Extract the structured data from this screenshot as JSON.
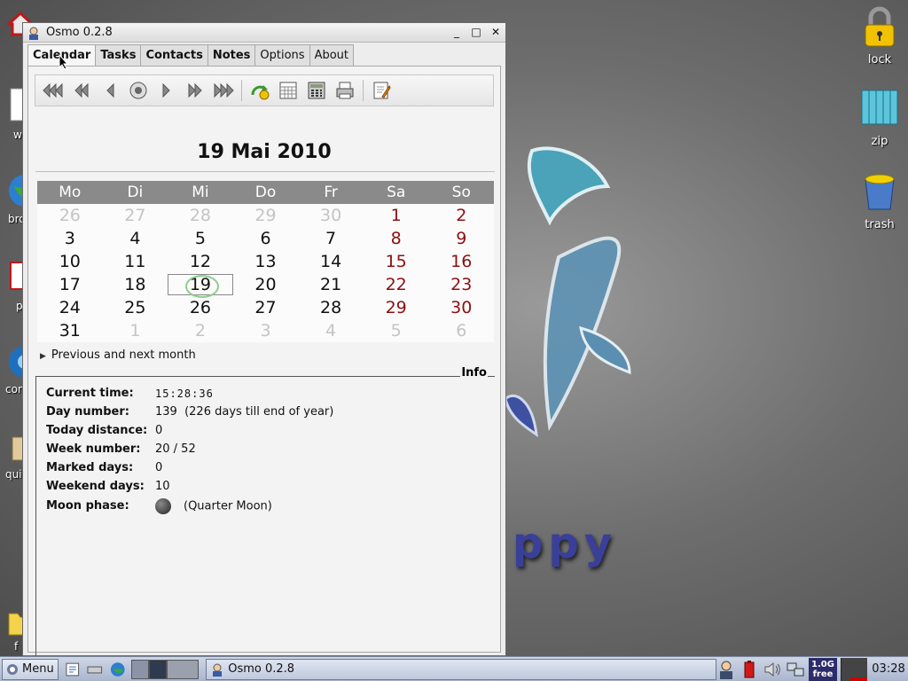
{
  "window": {
    "title": "Osmo 0.2.8",
    "minimize": "_",
    "maximize": "□",
    "close": "✕"
  },
  "tabs": [
    {
      "label": "Calendar"
    },
    {
      "label": "Tasks"
    },
    {
      "label": "Contacts"
    },
    {
      "label": "Notes"
    },
    {
      "label": "Options"
    },
    {
      "label": "About"
    }
  ],
  "toolbar": {
    "icons": [
      "prev-year-icon",
      "prev-month-icon",
      "prev-day-icon",
      "today-icon",
      "next-day-icon",
      "next-month-icon",
      "next-year-icon",
      "jump-to-date-icon",
      "full-year-icon",
      "calculator-icon",
      "print-icon",
      "notes-edit-icon"
    ]
  },
  "calendar": {
    "date_title": "19 Mai 2010",
    "weekdays": [
      "Mo",
      "Di",
      "Mi",
      "Do",
      "Fr",
      "Sa",
      "So"
    ],
    "weeks": [
      [
        "26",
        "27",
        "28",
        "29",
        "30",
        "1",
        "2"
      ],
      [
        "3",
        "4",
        "5",
        "6",
        "7",
        "8",
        "9"
      ],
      [
        "10",
        "11",
        "12",
        "13",
        "14",
        "15",
        "16"
      ],
      [
        "17",
        "18",
        "19",
        "20",
        "21",
        "22",
        "23"
      ],
      [
        "24",
        "25",
        "26",
        "27",
        "28",
        "29",
        "30"
      ],
      [
        "31",
        "1",
        "2",
        "3",
        "4",
        "5",
        "6"
      ]
    ],
    "selected_day": "19",
    "expander_label": "Previous and next month"
  },
  "info": {
    "frame_label": "Info",
    "rows": [
      {
        "key": "Current time:",
        "value": "15:28:36"
      },
      {
        "key": "Day number:",
        "value": "139  (226 days till end of year)"
      },
      {
        "key": "Today distance:",
        "value": "0"
      },
      {
        "key": "Week number:",
        "value": "20 / 52"
      },
      {
        "key": "Marked days:",
        "value": "0"
      },
      {
        "key": "Weekend days:",
        "value": "10"
      },
      {
        "key": "Moon phase:",
        "value": "(Quarter Moon)"
      }
    ]
  },
  "desktop": {
    "icons": [
      {
        "label": "lock"
      },
      {
        "label": "zip"
      },
      {
        "label": "trash"
      }
    ],
    "left_labels": [
      "w",
      "bro",
      "p",
      "con",
      "qui",
      "f"
    ],
    "wallpaper_text": "ppy"
  },
  "taskbar": {
    "menu_label": "Menu",
    "task_label": "Osmo 0.2.8",
    "free_space": "1.0G free",
    "clock": "03:28"
  }
}
